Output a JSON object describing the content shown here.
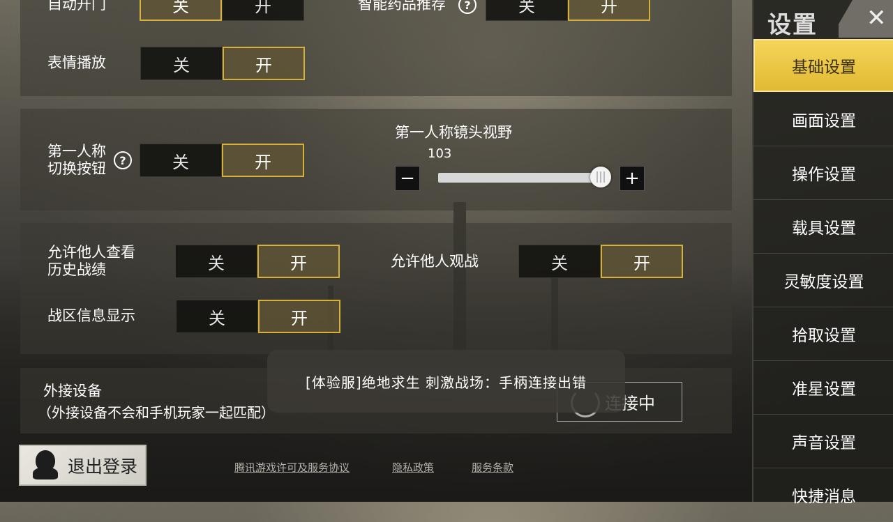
{
  "sidebar": {
    "title": "设置",
    "close_label": "✕",
    "items": [
      {
        "label": "基础设置"
      },
      {
        "label": "画面设置"
      },
      {
        "label": "操作设置"
      },
      {
        "label": "载具设置"
      },
      {
        "label": "灵敏度设置"
      },
      {
        "label": "拾取设置"
      },
      {
        "label": "准星设置"
      },
      {
        "label": "声音设置"
      },
      {
        "label": "快捷消息"
      }
    ]
  },
  "toggle_labels": {
    "off": "关",
    "on": "开"
  },
  "settings": {
    "auto_door": {
      "label": "自动开门",
      "state": "off"
    },
    "smart_medicine": {
      "label": "智能药品推荐",
      "state": "on"
    },
    "emote_play": {
      "label": "表情播放",
      "state": "on"
    },
    "fpp_switch": {
      "label_line1": "第一人称",
      "label_line2": "切换按钮",
      "state": "on"
    },
    "fpp_fov": {
      "label": "第一人称镜头视野",
      "value": "103",
      "min_label": "−",
      "max_label": "+"
    },
    "allow_history": {
      "label_line1": "允许他人查看",
      "label_line2": "历史战绩",
      "state": "on"
    },
    "allow_spectate": {
      "label": "允许他人观战",
      "state": "on"
    },
    "zone_info": {
      "label": "战区信息显示",
      "state": "on"
    }
  },
  "external_device": {
    "title": "外接设备",
    "note": "（外接设备不会和手机玩家一起匹配）",
    "button_label": "连接中"
  },
  "toast": {
    "text": "[体验服]绝地求生 刺激战场：手柄连接出错"
  },
  "logout": {
    "label": "退出登录"
  },
  "footer": {
    "license": "腾讯游戏许可及服务协议",
    "privacy": "隐私政策",
    "terms": "服务条款"
  },
  "help_icon": "?",
  "colors": {
    "accent_gold": "#d6b13a",
    "active_tab": "#f4d55a"
  }
}
